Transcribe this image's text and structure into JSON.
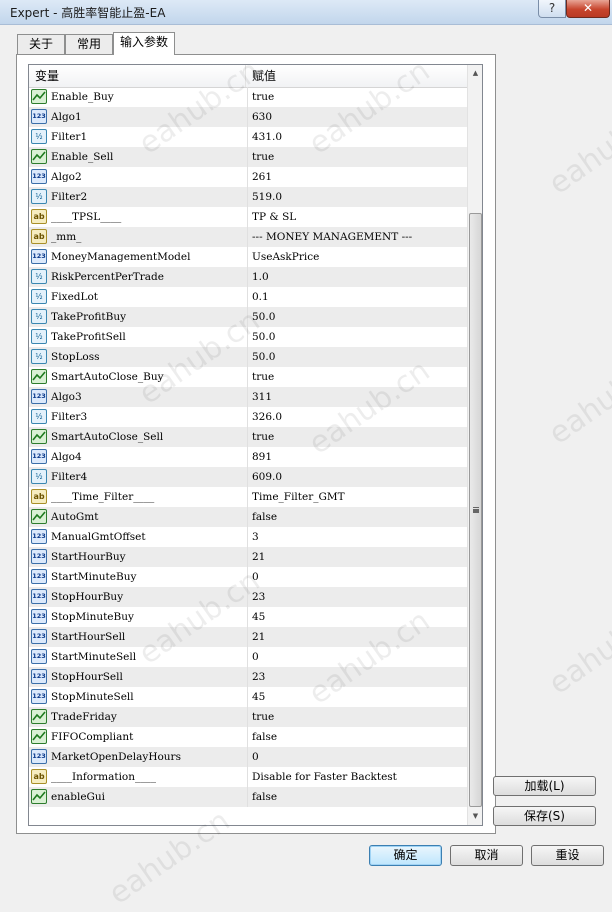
{
  "window": {
    "title": "Expert - 高胜率智能止盈-EA",
    "help": "?",
    "close": "✕"
  },
  "tabs": [
    {
      "label": "关于"
    },
    {
      "label": "常用"
    },
    {
      "label": "输入参数"
    }
  ],
  "grid": {
    "headers": {
      "variable": "变量",
      "value": "赋值"
    },
    "rows": [
      {
        "type": "bool",
        "name": "Enable_Buy",
        "value": "true"
      },
      {
        "type": "int",
        "name": "Algo1",
        "value": "630"
      },
      {
        "type": "double",
        "name": "Filter1",
        "value": "431.0"
      },
      {
        "type": "bool",
        "name": "Enable_Sell",
        "value": "true"
      },
      {
        "type": "int",
        "name": "Algo2",
        "value": "261"
      },
      {
        "type": "double",
        "name": "Filter2",
        "value": "519.0"
      },
      {
        "type": "string",
        "name": "____TPSL____",
        "value": "TP & SL"
      },
      {
        "type": "string",
        "name": "_mm_",
        "value": "--- MONEY MANAGEMENT ---"
      },
      {
        "type": "int",
        "name": "MoneyManagementModel",
        "value": "UseAskPrice"
      },
      {
        "type": "double",
        "name": "RiskPercentPerTrade",
        "value": "1.0"
      },
      {
        "type": "double",
        "name": "FixedLot",
        "value": "0.1"
      },
      {
        "type": "double",
        "name": "TakeProfitBuy",
        "value": "50.0"
      },
      {
        "type": "double",
        "name": "TakeProfitSell",
        "value": "50.0"
      },
      {
        "type": "double",
        "name": "StopLoss",
        "value": "50.0"
      },
      {
        "type": "bool",
        "name": "SmartAutoClose_Buy",
        "value": "true"
      },
      {
        "type": "int",
        "name": "Algo3",
        "value": "311"
      },
      {
        "type": "double",
        "name": "Filter3",
        "value": "326.0"
      },
      {
        "type": "bool",
        "name": "SmartAutoClose_Sell",
        "value": "true"
      },
      {
        "type": "int",
        "name": "Algo4",
        "value": "891"
      },
      {
        "type": "double",
        "name": "Filter4",
        "value": "609.0"
      },
      {
        "type": "string",
        "name": "____Time_Filter____",
        "value": "Time_Filter_GMT"
      },
      {
        "type": "bool",
        "name": "AutoGmt",
        "value": "false"
      },
      {
        "type": "int",
        "name": "ManualGmtOffset",
        "value": "3"
      },
      {
        "type": "int",
        "name": "StartHourBuy",
        "value": "21"
      },
      {
        "type": "int",
        "name": "StartMinuteBuy",
        "value": "0"
      },
      {
        "type": "int",
        "name": "StopHourBuy",
        "value": "23"
      },
      {
        "type": "int",
        "name": "StopMinuteBuy",
        "value": "45"
      },
      {
        "type": "int",
        "name": "StartHourSell",
        "value": "21"
      },
      {
        "type": "int",
        "name": "StartMinuteSell",
        "value": "0"
      },
      {
        "type": "int",
        "name": "StopHourSell",
        "value": "23"
      },
      {
        "type": "int",
        "name": "StopMinuteSell",
        "value": "45"
      },
      {
        "type": "bool",
        "name": "TradeFriday",
        "value": "true"
      },
      {
        "type": "bool",
        "name": "FIFOCompliant",
        "value": "false"
      },
      {
        "type": "int",
        "name": "MarketOpenDelayHours",
        "value": "0"
      },
      {
        "type": "string",
        "name": "____Information____",
        "value": "Disable for Faster Backtest"
      },
      {
        "type": "bool",
        "name": "enableGui",
        "value": "false"
      }
    ]
  },
  "type_icons": {
    "bool": "bool-icon",
    "int": "123",
    "double": "½",
    "string": "ab"
  },
  "side_buttons": {
    "load": "加载(L)",
    "save": "保存(S)"
  },
  "footer_buttons": {
    "ok": "确定",
    "cancel": "取消",
    "reset": "重设"
  },
  "watermark": "eahub.cn"
}
